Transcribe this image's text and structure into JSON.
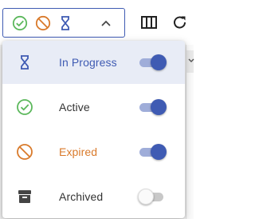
{
  "colors": {
    "accent": "#3f5bb3",
    "active_green": "#5cb85c",
    "expired_orange": "#d97a2b",
    "archived_dark": "#444444",
    "selected_bg": "#e8ecf6"
  },
  "filter_select": {
    "selected_icons": [
      "check-circle-icon",
      "block-icon",
      "hourglass-icon"
    ],
    "expanded": true
  },
  "toolbar": {
    "icons": [
      "columns-icon",
      "refresh-icon"
    ]
  },
  "menu": {
    "items": [
      {
        "label": "In Progress",
        "icon": "hourglass-icon",
        "enabled": true,
        "selected": true,
        "label_color": "#3f5bb3"
      },
      {
        "label": "Active",
        "icon": "check-circle-icon",
        "enabled": true,
        "selected": false,
        "label_color": "#333333"
      },
      {
        "label": "Expired",
        "icon": "block-icon",
        "enabled": true,
        "selected": false,
        "label_color": "#d97a2b"
      },
      {
        "label": "Archived",
        "icon": "archive-box-icon",
        "enabled": false,
        "selected": false,
        "label_color": "#333333"
      }
    ]
  }
}
